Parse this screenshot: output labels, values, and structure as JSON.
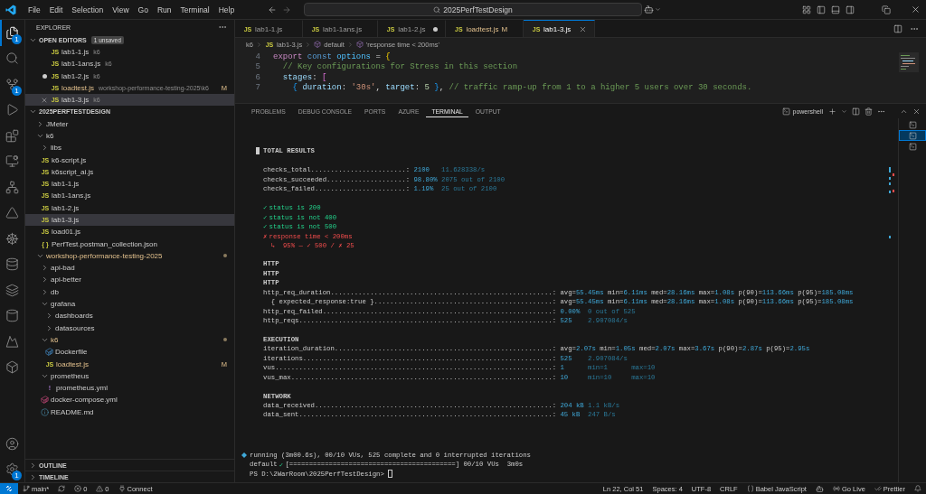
{
  "title_bar": {
    "menu": [
      "File",
      "Edit",
      "Selection",
      "View",
      "Go",
      "Run",
      "Terminal",
      "Help"
    ],
    "search": "2025PerfTestDesign"
  },
  "activity_bar": {
    "top": [
      {
        "kind": "files",
        "selected": true,
        "badge": "1"
      },
      {
        "kind": "search",
        "selected": false
      },
      {
        "kind": "source",
        "selected": false,
        "badge": "1"
      },
      {
        "kind": "run",
        "selected": false
      },
      {
        "kind": "extensions",
        "selected": false
      },
      {
        "kind": "remote",
        "selected": false
      },
      {
        "kind": "network",
        "selected": false
      },
      {
        "kind": "azure",
        "selected": false
      },
      {
        "kind": "helm",
        "selected": false
      },
      {
        "kind": "database",
        "selected": false
      },
      {
        "kind": "layers",
        "selected": false
      },
      {
        "kind": "cylinder",
        "selected": false
      },
      {
        "kind": "mountain",
        "selected": false
      },
      {
        "kind": "box",
        "selected": false
      }
    ],
    "bottom": [
      {
        "kind": "account",
        "selected": false
      },
      {
        "kind": "settings",
        "selected": false,
        "badge": "1"
      }
    ]
  },
  "explorer": {
    "title": "EXPLORER",
    "open_editors": {
      "title": "OPEN EDITORS",
      "expanded": true,
      "badge": "1 unsaved",
      "items": [
        {
          "name": "lab1-1.js",
          "kind": "js",
          "icon_text": "JS",
          "desc": "k6",
          "dirty": false,
          "selected": false,
          "modified": false
        },
        {
          "name": "lab1-1ans.js",
          "kind": "js",
          "icon_text": "JS",
          "desc": "k6",
          "dirty": false,
          "selected": false,
          "modified": false
        },
        {
          "name": "lab1-2.js",
          "kind": "js",
          "icon_text": "JS",
          "desc": "k6",
          "dirty": true,
          "selected": false,
          "modified": false
        },
        {
          "name": "loadtest.js",
          "kind": "js",
          "icon_text": "JS",
          "desc": "workshop-performance-testing-2025\\k6",
          "dirty": false,
          "selected": false,
          "modified": true,
          "git": "M"
        },
        {
          "name": "lab1-3.js",
          "kind": "js",
          "icon_text": "JS",
          "desc": "k6",
          "dirty": false,
          "selected": true,
          "modified": false
        }
      ]
    },
    "folder": {
      "title": "2025PERFTESTDESIGN",
      "expanded": true,
      "children": [
        {
          "name": "JMeter",
          "kind": "folder",
          "expanded": false,
          "selected": false,
          "modified": false
        },
        {
          "name": "k6",
          "kind": "folder",
          "expanded": true,
          "selected": false,
          "modified": false,
          "children": [
            {
              "name": "libs",
              "kind": "folder",
              "expanded": false,
              "selected": false,
              "modified": false
            },
            {
              "name": "k6-script.js",
              "kind": "js",
              "icon_text": "JS",
              "selected": false,
              "modified": false
            },
            {
              "name": "k6script_ai.js",
              "kind": "js",
              "icon_text": "JS",
              "selected": false,
              "modified": false
            },
            {
              "name": "lab1-1.js",
              "kind": "js",
              "icon_text": "JS",
              "selected": false,
              "modified": false
            },
            {
              "name": "lab1-1ans.js",
              "kind": "js",
              "icon_text": "JS",
              "selected": false,
              "modified": false
            },
            {
              "name": "lab1-2.js",
              "kind": "js",
              "icon_text": "JS",
              "selected": false,
              "modified": false
            },
            {
              "name": "lab1-3.js",
              "kind": "js",
              "icon_text": "JS",
              "selected": true,
              "modified": false
            },
            {
              "name": "load01.js",
              "kind": "js",
              "icon_text": "JS",
              "selected": false,
              "modified": false
            },
            {
              "name": "PerfTest.postman_collection.json",
              "kind": "json",
              "icon_text": "{ }",
              "selected": false,
              "modified": false
            }
          ]
        },
        {
          "name": "workshop-performance-testing-2025",
          "kind": "folder",
          "expanded": true,
          "selected": false,
          "modified": true,
          "children": [
            {
              "name": "api-bad",
              "kind": "folder",
              "expanded": false,
              "selected": false,
              "modified": false
            },
            {
              "name": "api-better",
              "kind": "folder",
              "expanded": false,
              "selected": false,
              "modified": false
            },
            {
              "name": "db",
              "kind": "folder",
              "expanded": false,
              "selected": false,
              "modified": false
            },
            {
              "name": "grafana",
              "kind": "folder",
              "expanded": true,
              "selected": false,
              "modified": false,
              "children": [
                {
                  "name": "dashboards",
                  "kind": "folder",
                  "expanded": false,
                  "selected": false,
                  "modified": false
                },
                {
                  "name": "datasources",
                  "kind": "folder",
                  "expanded": false,
                  "selected": false,
                  "modified": false
                }
              ]
            },
            {
              "name": "k6",
              "kind": "folder",
              "expanded": true,
              "selected": false,
              "modified": true,
              "children": [
                {
                  "name": "Dockerfile",
                  "kind": "docker",
                  "selected": false,
                  "modified": false
                },
                {
                  "name": "loadtest.js",
                  "kind": "js",
                  "icon_text": "JS",
                  "selected": false,
                  "modified": true,
                  "git": "M"
                }
              ]
            },
            {
              "name": "prometheus",
              "kind": "folder",
              "expanded": true,
              "selected": false,
              "modified": false,
              "children": [
                {
                  "name": "prometheus.yml",
                  "kind": "yaml",
                  "icon_text": "!",
                  "selected": false,
                  "modified": false
                }
              ]
            },
            {
              "name": "docker-compose.yml",
              "kind": "compose",
              "selected": false,
              "modified": false
            },
            {
              "name": "README.md",
              "kind": "info",
              "selected": false,
              "modified": false
            }
          ]
        }
      ]
    },
    "outline": {
      "title": "OUTLINE",
      "expanded": false
    },
    "timeline": {
      "title": "TIMELINE",
      "expanded": false
    }
  },
  "tabs": [
    {
      "name": "lab1-1.js",
      "icon_text": "JS",
      "selected": false,
      "dirty": false,
      "modified": false
    },
    {
      "name": "lab1-1ans.js",
      "icon_text": "JS",
      "selected": false,
      "dirty": false,
      "modified": false
    },
    {
      "name": "lab1-2.js",
      "icon_text": "JS",
      "selected": false,
      "dirty": true,
      "modified": false
    },
    {
      "name": "loadtest.js",
      "icon_text": "JS",
      "selected": false,
      "dirty": false,
      "modified": true,
      "git": "M"
    },
    {
      "name": "lab1-3.js",
      "icon_text": "JS",
      "selected": true,
      "dirty": false,
      "modified": false
    }
  ],
  "breadcrumb": [
    {
      "text": "k6",
      "kind": "folder"
    },
    {
      "text": "lab1-3.js",
      "kind": "js",
      "icon_text": "JS"
    },
    {
      "text": "default",
      "kind": "symbol"
    },
    {
      "text": "'response time < 200ms'",
      "kind": "symbol"
    }
  ],
  "code": [
    {
      "number": "4",
      "tokens": [
        {
          "t": "export ",
          "kind": "kw"
        },
        {
          "t": "const ",
          "kind": "decl"
        },
        {
          "t": "options",
          "kind": "const"
        },
        {
          "t": " = ",
          "kind": "plain"
        },
        {
          "t": "{",
          "kind": "brace"
        }
      ]
    },
    {
      "number": "5",
      "tokens": [
        {
          "t": "  // Key configurations for Stress in this section",
          "kind": "comment"
        }
      ]
    },
    {
      "number": "6",
      "tokens": [
        {
          "t": "  stages",
          "kind": "prop"
        },
        {
          "t": ": ",
          "kind": "plain"
        },
        {
          "t": "[",
          "kind": "brace2"
        }
      ]
    },
    {
      "number": "7",
      "tokens": [
        {
          "t": "    { ",
          "kind": "brace3"
        },
        {
          "t": "duration",
          "kind": "prop"
        },
        {
          "t": ": ",
          "kind": "plain"
        },
        {
          "t": "'30s'",
          "kind": "str"
        },
        {
          "t": ", ",
          "kind": "plain"
        },
        {
          "t": "target",
          "kind": "prop"
        },
        {
          "t": ": ",
          "kind": "plain"
        },
        {
          "t": "5",
          "kind": "num"
        },
        {
          "t": " }",
          "kind": "brace3"
        },
        {
          "t": ", ",
          "kind": "plain"
        },
        {
          "t": "// traffic ramp-up from 1 to a higher 5 users over 30 seconds.",
          "kind": "comment"
        }
      ]
    }
  ],
  "panel": {
    "tabs": [
      {
        "label": "PROBLEMS",
        "selected": false
      },
      {
        "label": "DEBUG CONSOLE",
        "selected": false
      },
      {
        "label": "PORTS",
        "selected": false
      },
      {
        "label": "AZURE",
        "selected": false
      },
      {
        "label": "TERMINAL",
        "selected": true
      },
      {
        "label": "OUTPUT",
        "selected": false
      }
    ],
    "shell": "powershell",
    "terminals": [
      {
        "selected": false
      },
      {
        "selected": true
      },
      {
        "selected": false
      }
    ]
  },
  "terminal": {
    "sections": [
      {
        "lines": [
          {
            "kind": "heading",
            "text": "TOTAL RESULTS",
            "marker": true
          }
        ]
      },
      {
        "lines": [
          {
            "kind": "metric",
            "name": "checks_total........................:",
            "value": "2100",
            "details": [
              "11.628338/s"
            ]
          },
          {
            "kind": "metric",
            "name": "checks_succeeded....................:",
            "value": "98.80%",
            "details": [
              "2075 out of 2100"
            ]
          },
          {
            "kind": "metric",
            "name": "checks_failed.......................:",
            "value": "1.19%",
            "details": [
              "25 out of 2100"
            ]
          }
        ]
      },
      {
        "lines": [
          {
            "kind": "check",
            "mark": "✓",
            "text": "status is 200",
            "passed": true
          },
          {
            "kind": "check",
            "mark": "✓",
            "text": "status is not 400",
            "passed": true
          },
          {
            "kind": "check",
            "mark": "✓",
            "text": "status is not 500",
            "passed": true
          },
          {
            "kind": "check",
            "mark": "✗",
            "text": "response time < 200ms",
            "passed": false
          },
          {
            "kind": "note",
            "text": "↳  95% — ✓ 500 / ✗ 25"
          }
        ]
      },
      {
        "lines": [
          {
            "kind": "heading",
            "text": "HTTP",
            "marker": false
          },
          {
            "kind": "heading",
            "text": "HTTP",
            "marker": false
          },
          {
            "kind": "heading",
            "text": "HTTP",
            "marker": false
          },
          {
            "kind": "stats",
            "name": "http_req_duration........................................................:",
            "stats": [
              "avg=55.45ms",
              "min=6.11ms",
              "med=28.16ms",
              "max=1.08s",
              "p(90)=113.66ms",
              "p(95)=185.08ms"
            ]
          },
          {
            "kind": "stats",
            "name": "  { expected_response:true }.............................................:",
            "stats": [
              "avg=55.45ms",
              "min=6.11ms",
              "med=28.16ms",
              "max=1.08s",
              "p(90)=113.66ms",
              "p(95)=185.08ms"
            ]
          },
          {
            "kind": "metric",
            "name": "http_req_failed..........................................................:",
            "value": "0.00%",
            "details": [
              "0 out of 525"
            ]
          },
          {
            "kind": "metric",
            "name": "http_reqs................................................................:",
            "value": "525",
            "details": [
              "2.907084/s"
            ]
          }
        ]
      },
      {
        "lines": [
          {
            "kind": "heading",
            "text": "EXECUTION",
            "marker": false
          },
          {
            "kind": "stats",
            "name": "iteration_duration.......................................................:",
            "stats": [
              "avg=2.07s",
              "min=1.05s",
              "med=2.07s",
              "max=3.67s",
              "p(90)=2.87s",
              "p(95)=2.95s"
            ]
          },
          {
            "kind": "metric",
            "name": "iterations...............................................................:",
            "value": "525",
            "details": [
              "2.907084/s"
            ]
          },
          {
            "kind": "metric",
            "name": "vus......................................................................:",
            "value": "1",
            "details": [
              "min=1",
              "max=10"
            ]
          },
          {
            "kind": "metric",
            "name": "vus_max..................................................................:",
            "value": "10",
            "details": [
              "min=10",
              "max=10"
            ]
          }
        ]
      },
      {
        "lines": [
          {
            "kind": "heading",
            "text": "NETWORK",
            "marker": false
          },
          {
            "kind": "metric",
            "name": "data_received............................................................:",
            "value": "204 kB",
            "details": [
              "1.1 kB/s"
            ]
          },
          {
            "kind": "metric",
            "name": "data_sent................................................................:",
            "value": "45 kB",
            "details": [
              "247 B/s"
            ]
          }
        ]
      }
    ],
    "running": "running (3m00.6s), 00/10 VUs, 525 complete and 0 interrupted iterations",
    "progress": {
      "label": "default",
      "mark": "✓",
      "bar": "[==========================================]",
      "text": "00/10 VUs  3m0s"
    },
    "prompt": "PS D:\\2WarRoom\\2025PerfTestDesign>"
  },
  "status_bar": {
    "left": [
      {
        "kind": "remote"
      },
      {
        "kind": "branch",
        "text": "main*"
      },
      {
        "kind": "sync"
      },
      {
        "kind": "errors",
        "text": "0"
      },
      {
        "kind": "warnings",
        "text": "0"
      },
      {
        "kind": "connect",
        "text": "Connect"
      }
    ],
    "right": [
      {
        "kind": "text",
        "text": "Ln 22, Col 51"
      },
      {
        "kind": "text",
        "text": "Spaces: 4"
      },
      {
        "kind": "text",
        "text": "UTF-8"
      },
      {
        "kind": "text",
        "text": "CRLF"
      },
      {
        "kind": "language",
        "text": "Babel JavaScript"
      },
      {
        "kind": "copilot"
      },
      {
        "kind": "live",
        "text": "Go Live"
      },
      {
        "kind": "prettier",
        "text": "Prettier"
      },
      {
        "kind": "bell"
      }
    ]
  }
}
